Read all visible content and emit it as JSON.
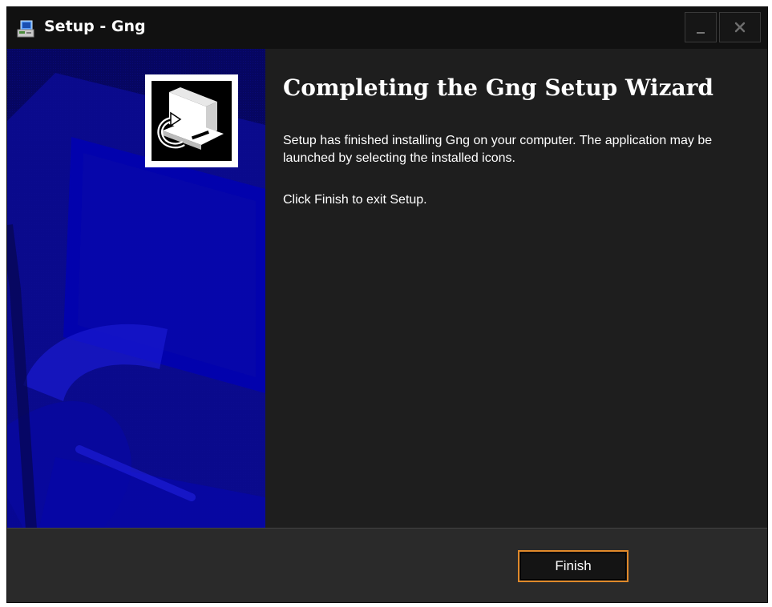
{
  "window": {
    "title": "Setup - Gng",
    "icons": {
      "app": "setup-app-icon",
      "minimize": "minimize-icon",
      "close": "close-icon"
    }
  },
  "wizard": {
    "heading": "Completing the Gng Setup Wizard",
    "paragraph_1": "Setup has finished installing Gng on your computer. The application may be launched by selecting the installed icons.",
    "paragraph_2": "Click Finish to exit Setup.",
    "banner_icon": "computer-install-icon"
  },
  "footer": {
    "finish_label": "Finish"
  },
  "colors": {
    "window_bg": "#1e1e1e",
    "titlebar_bg": "#111111",
    "banner_bg": "#07075a",
    "footer_bg": "#2a2a2a",
    "accent": "#e0892a"
  }
}
